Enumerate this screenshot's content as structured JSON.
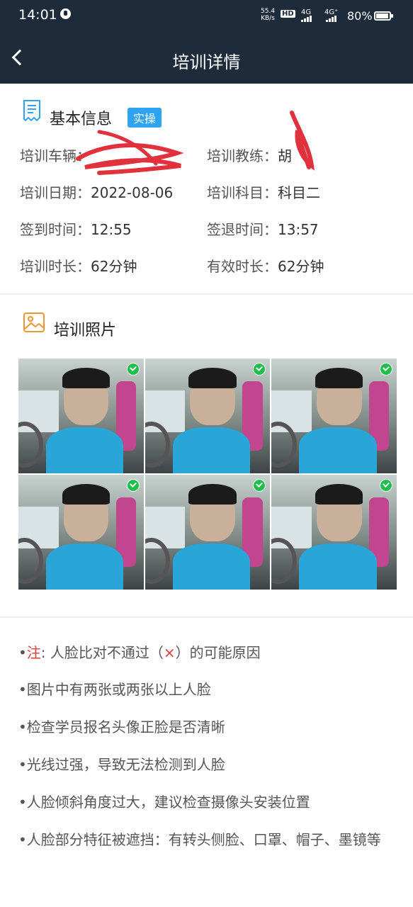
{
  "status_bar": {
    "time": "14:01",
    "speed_value": "55.4",
    "speed_unit": "KB/s",
    "hd_badge": "HD",
    "net1": "4G",
    "net2": "4G⁺",
    "battery": "80%"
  },
  "nav": {
    "title": "培训详情"
  },
  "basic_info": {
    "title": "基本信息",
    "badge": "实操",
    "rows": [
      {
        "label": "培训车辆：",
        "value": ""
      },
      {
        "label": "培训教练：",
        "value": "胡"
      },
      {
        "label": "培训日期：",
        "value": "2022-08-06"
      },
      {
        "label": "培训科目：",
        "value": "科目二"
      },
      {
        "label": "签到时间：",
        "value": "12:55"
      },
      {
        "label": "签退时间：",
        "value": "13:57"
      },
      {
        "label": "培训时长：",
        "value": "62分钟"
      },
      {
        "label": "有效时长：",
        "value": "62分钟"
      }
    ]
  },
  "photos": {
    "title": "培训照片",
    "items": [
      {
        "status": "pass"
      },
      {
        "status": "pass"
      },
      {
        "status": "pass"
      },
      {
        "status": "pass"
      },
      {
        "status": "pass"
      },
      {
        "status": "pass"
      }
    ]
  },
  "notes": {
    "prefix": "•",
    "head_label": "注",
    "head_text": ": 人脸比对不通过（",
    "head_mark": "×",
    "head_tail": "）的可能原因",
    "items": [
      "•图片中有两张或两张以上人脸",
      "•检查学员报名头像正脸是否清晰",
      "•光线过强，导致无法检测到人脸",
      "•人脸倾斜角度过大，建议检查摄像头安装位置",
      "•人脸部分特征被遮挡：有转头侧脸、口罩、帽子、墨镜等"
    ]
  },
  "colors": {
    "nav_bg": "#1d2b3a",
    "badge_bg": "#2ea3f2",
    "check_green": "#1fbf4b",
    "note_red": "#e03a3a",
    "scribble_red": "#e0313c"
  }
}
